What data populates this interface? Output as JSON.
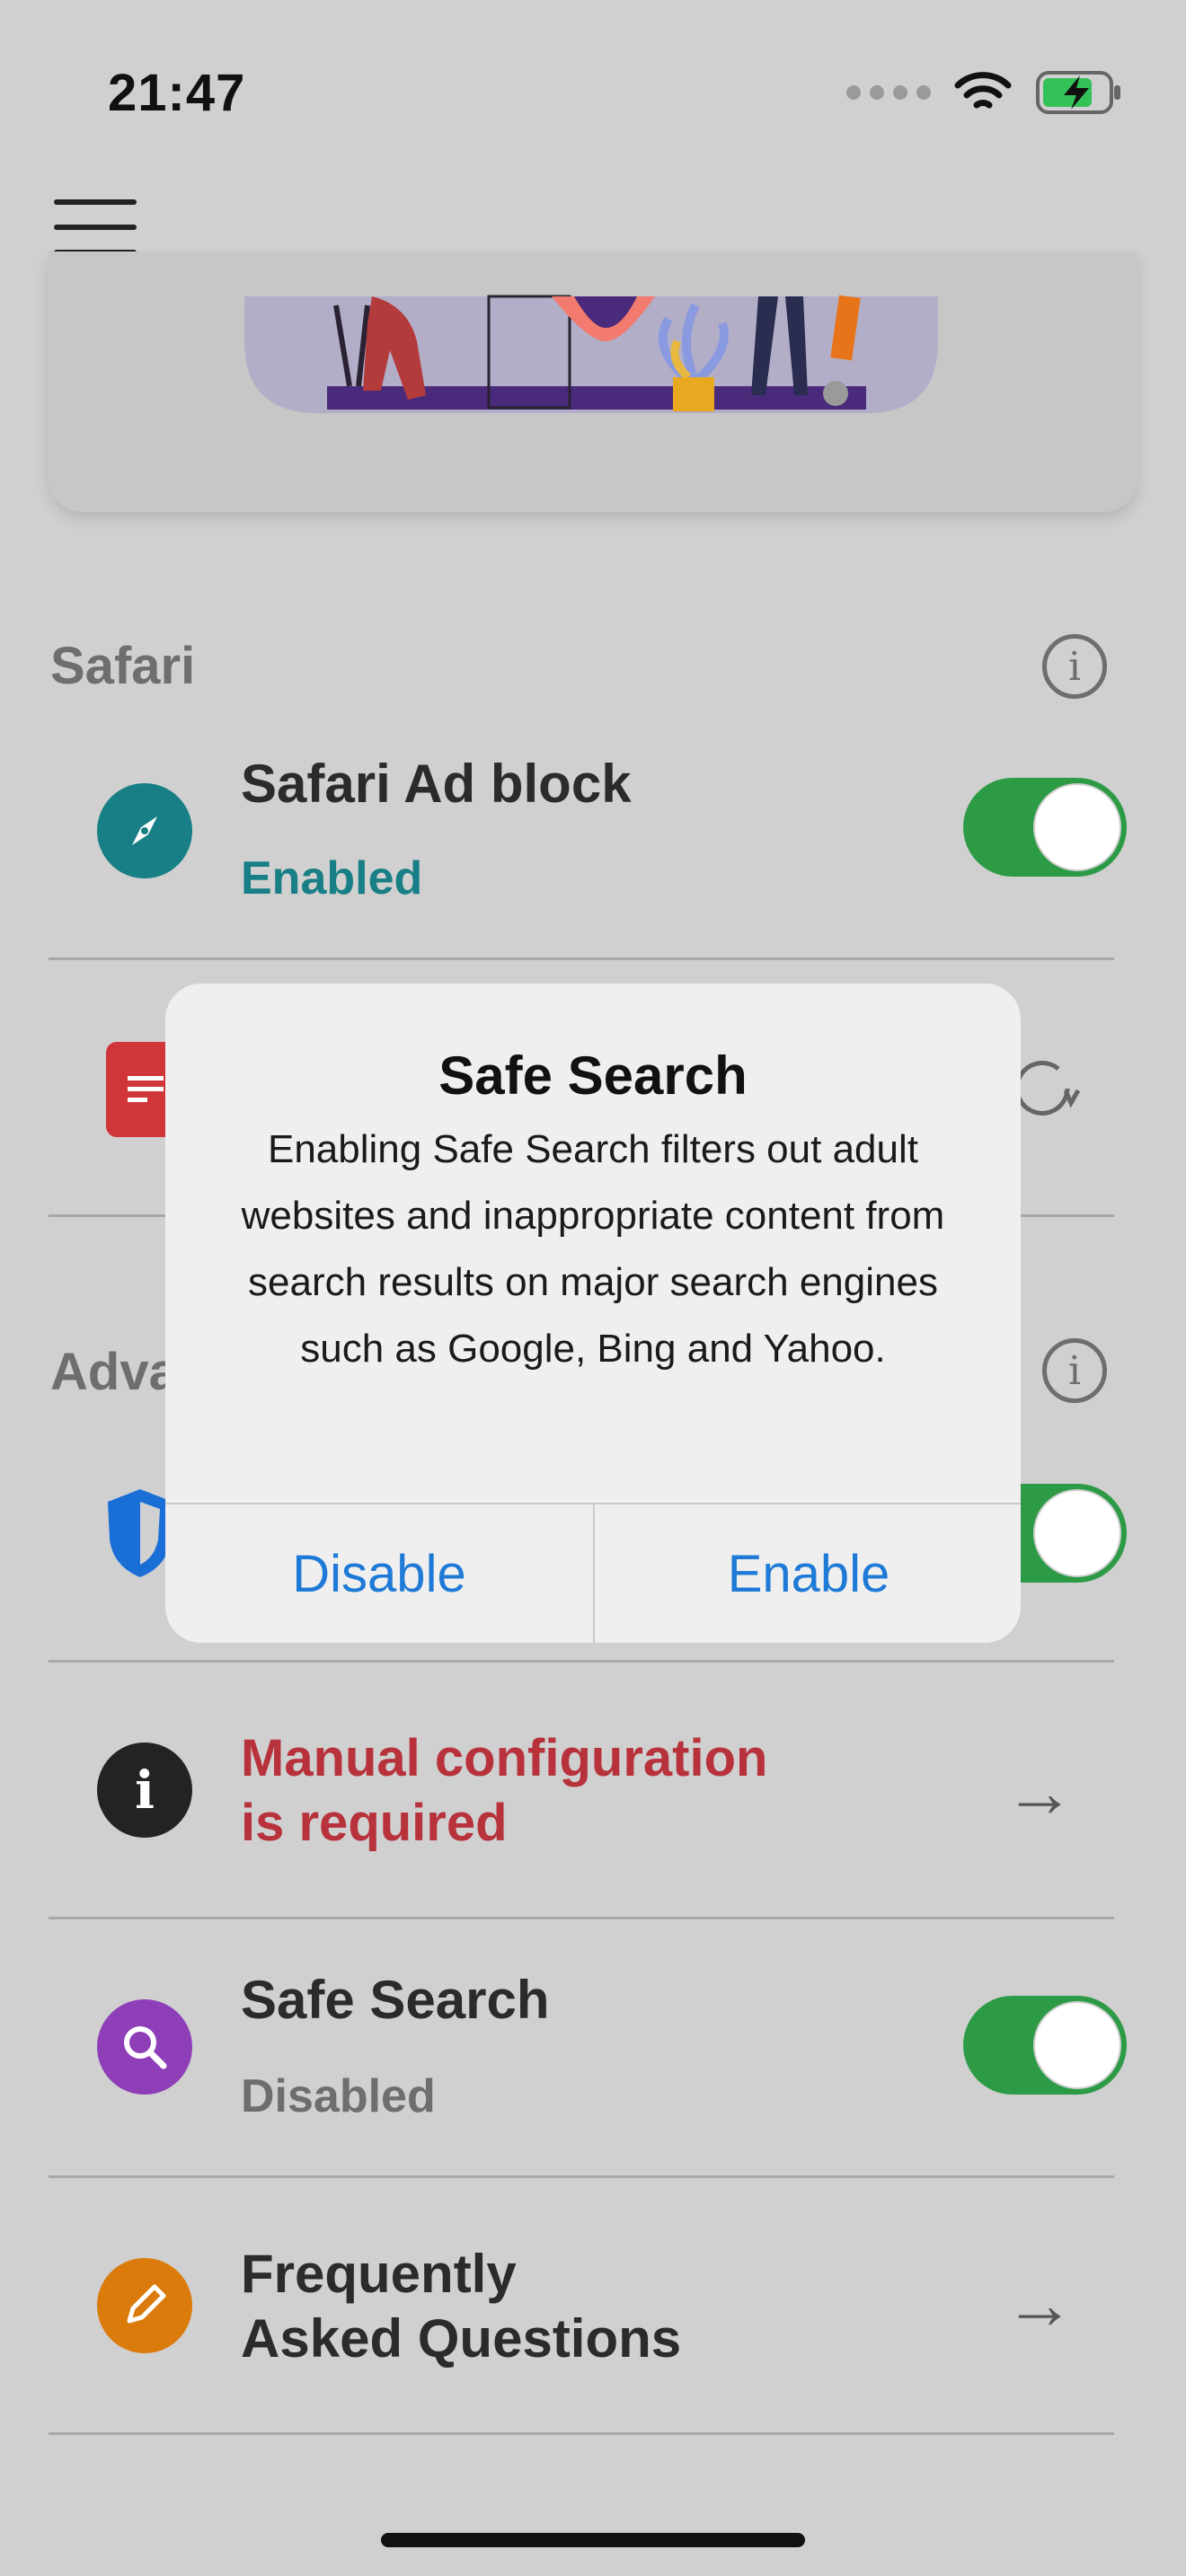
{
  "status_bar": {
    "time": "21:47"
  },
  "sections": {
    "safari": {
      "title": "Safari"
    },
    "advanced": {
      "title": "Adva"
    }
  },
  "rows": {
    "safari_ad_block": {
      "title": "Safari Ad block",
      "status": "Enabled"
    },
    "manual_config": {
      "line1": "Manual configuration",
      "line2": "is required"
    },
    "safe_search": {
      "title": "Safe Search",
      "status": "Disabled"
    },
    "faq": {
      "line1": "Frequently",
      "line2": "Asked Questions"
    }
  },
  "alert": {
    "title": "Safe Search",
    "message": "Enabling Safe Search filters out adult websites and inappropriate content from search results on major search engines such as Google, Bing and Yahoo.",
    "disable_label": "Disable",
    "enable_label": "Enable"
  },
  "colors": {
    "toggle_on": "#2d9b46",
    "enabled_text": "#177f85",
    "warning_text": "#b8323c",
    "alert_button": "#1e7ad6"
  }
}
